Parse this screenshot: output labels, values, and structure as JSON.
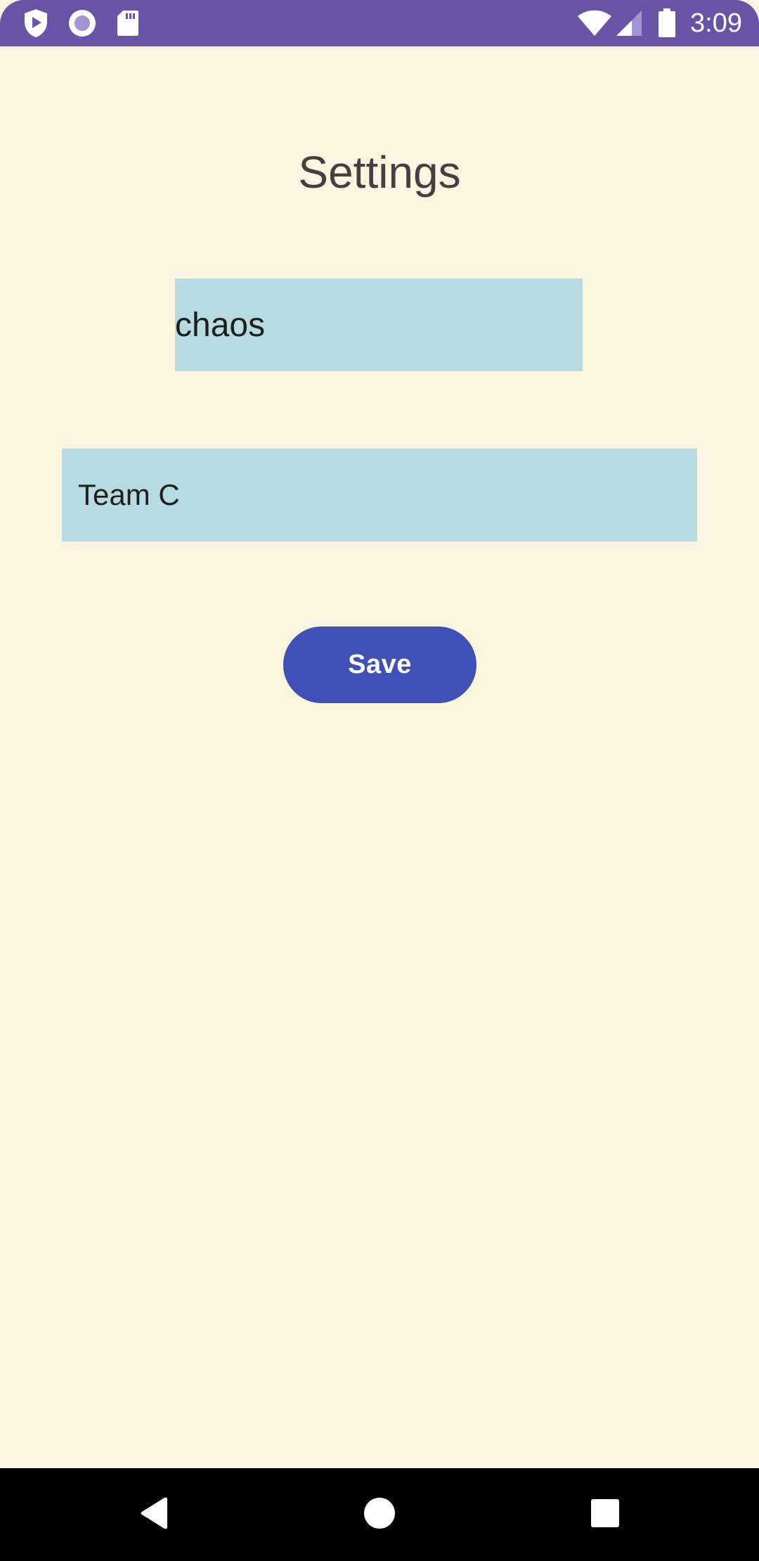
{
  "status_bar": {
    "time": "3:09",
    "left_icons": [
      "shield-play-icon",
      "record-circle-icon",
      "sd-card-icon"
    ],
    "right_icons": [
      "wifi-icon",
      "cell-signal-icon",
      "battery-icon"
    ],
    "background": "#6A52A6"
  },
  "settings": {
    "title": "Settings",
    "nickname_value": "chaos",
    "team_value": "Team C",
    "save_label": "Save"
  },
  "nav_bar": {
    "icons": [
      "back-icon",
      "home-icon",
      "recents-icon"
    ]
  },
  "colors": {
    "background": "#FBF5DF",
    "field": "#B8DAE3",
    "accent": "#3F51B5",
    "title_text": "#453F42"
  }
}
